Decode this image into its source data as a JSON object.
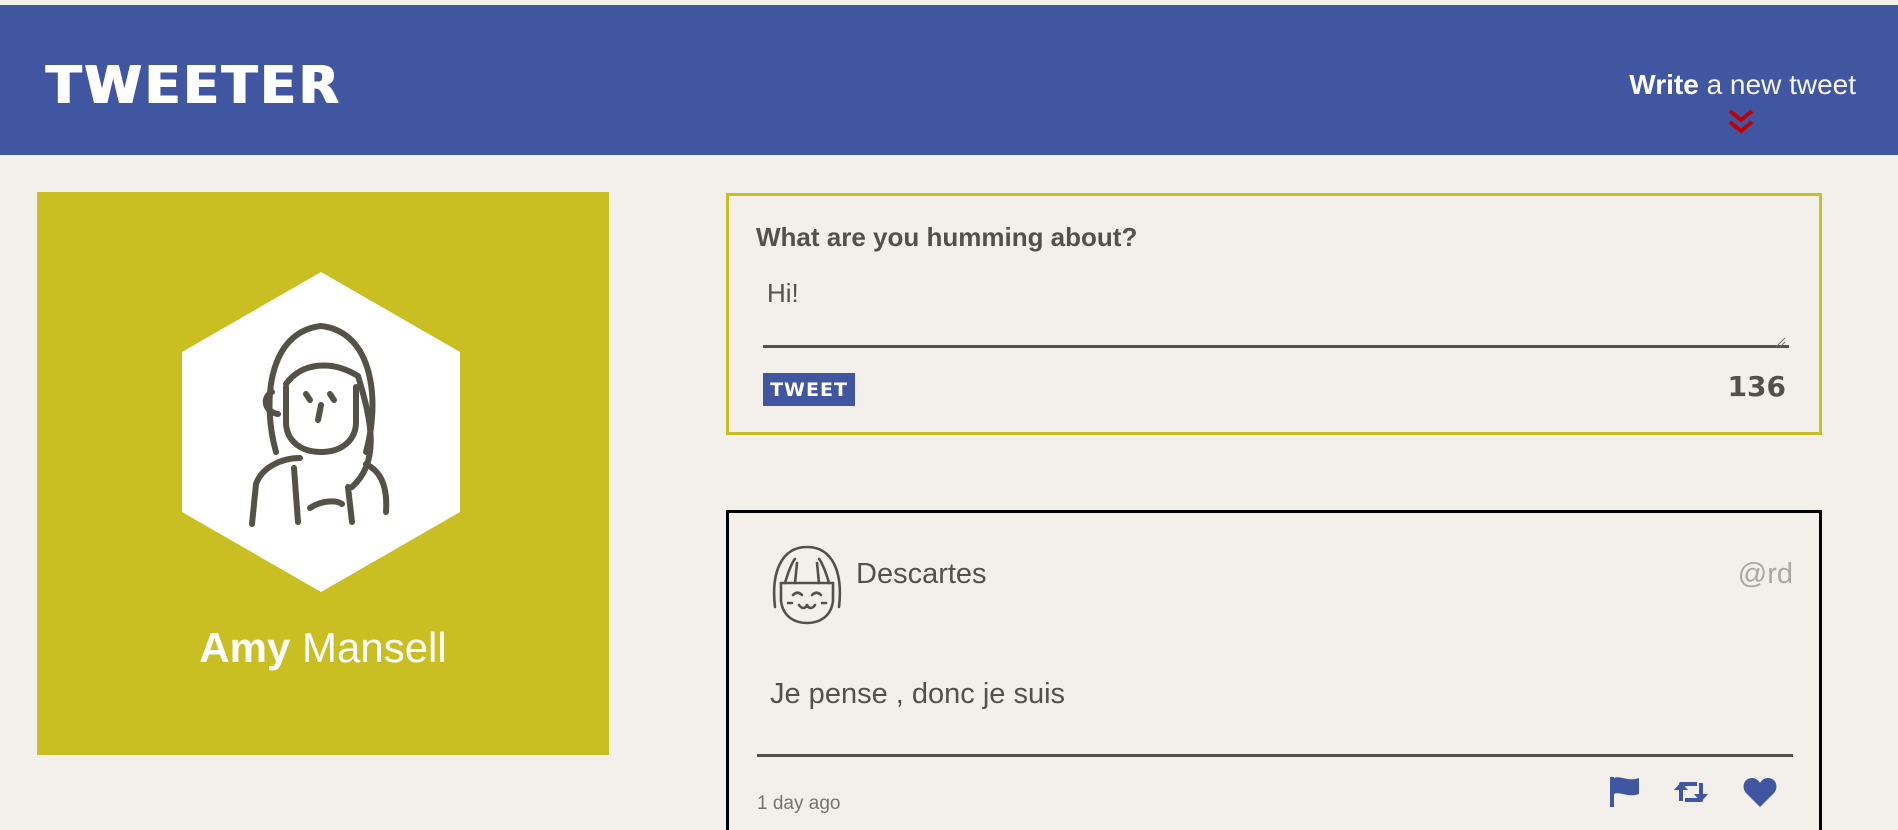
{
  "header": {
    "logo": "TWEETER",
    "compose_strong": "Write",
    "compose_light": "a new tweet"
  },
  "profile": {
    "first_name": "Amy",
    "last_name": "Mansell"
  },
  "compose": {
    "label": "What are you humming about?",
    "text": "Hi!",
    "button_label": "TWEET",
    "counter": "136"
  },
  "tweets": [
    {
      "name": "Descartes",
      "handle": "@rd",
      "content": "Je pense , donc je suis",
      "timestamp": "1 day ago"
    }
  ],
  "colors": {
    "primary": "#4056a1",
    "accent": "#c9bf22",
    "background": "#f3f0ec",
    "text": "#545149",
    "chevron": "#c00000"
  },
  "icons": {
    "toggle": "chevron-double-down-icon",
    "flag": "flag-icon",
    "retweet": "retweet-icon",
    "like": "heart-icon"
  }
}
